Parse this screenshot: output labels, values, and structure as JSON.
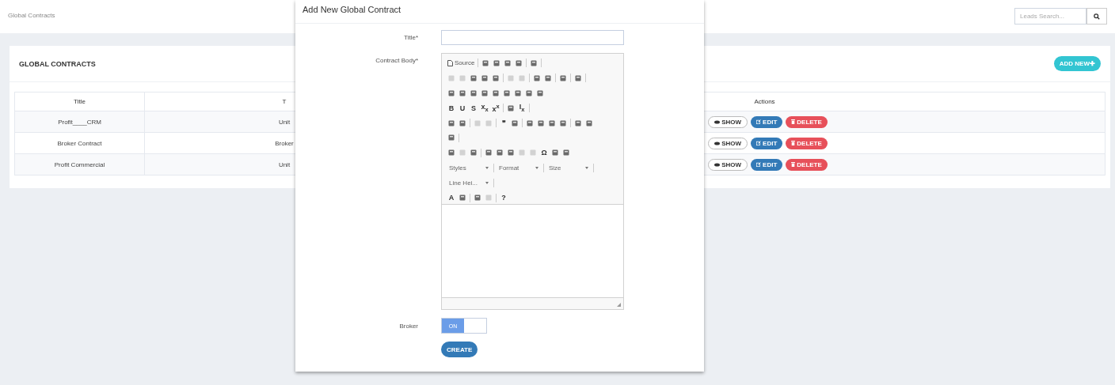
{
  "breadcrumb": "Global Contracts",
  "search": {
    "placeholder": "Leads Search..."
  },
  "card": {
    "title": "GLOBAL CONTRACTS",
    "add_button": "ADD NEW✚"
  },
  "table": {
    "columns": [
      "Title",
      "T",
      "Actions"
    ],
    "rows": [
      {
        "title": "Profit____CRM",
        "column_2": "Unit",
        "actions": [
          "SHOW",
          "EDIT",
          "DELETE"
        ]
      },
      {
        "title": "Broker Contract",
        "column_2": "Broker",
        "actions": [
          "SHOW",
          "EDIT",
          "DELETE"
        ]
      },
      {
        "title": "Profit Commercial",
        "column_2": "Unit",
        "actions": [
          "SHOW",
          "EDIT",
          "DELETE"
        ]
      }
    ]
  },
  "modal": {
    "title": "Add New Global Contract",
    "title_label": "Title*",
    "body_label": "Contract Body*",
    "toolbar": [
      [
        {
          "kind": "source",
          "label": "Source"
        },
        {
          "kind": "sep"
        },
        {
          "kind": "icon"
        },
        {
          "kind": "icon"
        },
        {
          "kind": "icon"
        },
        {
          "kind": "icon"
        },
        {
          "kind": "sep"
        },
        {
          "kind": "icon"
        },
        {
          "kind": "sep"
        }
      ],
      [
        {
          "kind": "faint"
        },
        {
          "kind": "faint"
        },
        {
          "kind": "icon"
        },
        {
          "kind": "icon"
        },
        {
          "kind": "icon"
        },
        {
          "kind": "sep"
        },
        {
          "kind": "faint"
        },
        {
          "kind": "faint"
        },
        {
          "kind": "sep"
        },
        {
          "kind": "icon"
        },
        {
          "kind": "icon"
        },
        {
          "kind": "sep"
        },
        {
          "kind": "icon"
        },
        {
          "kind": "sep"
        },
        {
          "kind": "icon"
        },
        {
          "kind": "sep"
        }
      ],
      [
        {
          "kind": "icon"
        },
        {
          "kind": "icon"
        },
        {
          "kind": "icon"
        },
        {
          "kind": "icon"
        },
        {
          "kind": "icon"
        },
        {
          "kind": "icon"
        },
        {
          "kind": "icon"
        },
        {
          "kind": "icon"
        },
        {
          "kind": "icon"
        }
      ],
      [
        {
          "kind": "glyph",
          "label": "B"
        },
        {
          "kind": "glyph",
          "label": "U"
        },
        {
          "kind": "glyph",
          "label": "S"
        },
        {
          "kind": "glyph",
          "label": "x$_{x}$"
        },
        {
          "kind": "glyph",
          "label": "x$^{x}$"
        },
        {
          "kind": "sep"
        },
        {
          "kind": "icon"
        },
        {
          "kind": "glyph",
          "label": "I$_{x}$"
        },
        {
          "kind": "sep"
        }
      ],
      [
        {
          "kind": "icon"
        },
        {
          "kind": "icon"
        },
        {
          "kind": "sep"
        },
        {
          "kind": "faint"
        },
        {
          "kind": "faint"
        },
        {
          "kind": "sep"
        },
        {
          "kind": "glyph",
          "label": "❞"
        },
        {
          "kind": "icon"
        },
        {
          "kind": "sep"
        },
        {
          "kind": "icon"
        },
        {
          "kind": "icon"
        },
        {
          "kind": "icon"
        },
        {
          "kind": "icon"
        },
        {
          "kind": "sep"
        },
        {
          "kind": "icon"
        },
        {
          "kind": "icon"
        }
      ],
      [
        {
          "kind": "icon"
        },
        {
          "kind": "sep"
        }
      ],
      [
        {
          "kind": "icon"
        },
        {
          "kind": "faint"
        },
        {
          "kind": "icon"
        },
        {
          "kind": "sep"
        },
        {
          "kind": "icon"
        },
        {
          "kind": "icon"
        },
        {
          "kind": "icon"
        },
        {
          "kind": "faint"
        },
        {
          "kind": "faint"
        },
        {
          "kind": "glyph",
          "label": "Ω"
        },
        {
          "kind": "icon"
        },
        {
          "kind": "icon"
        }
      ],
      [
        {
          "kind": "combo",
          "label": "Styles"
        },
        {
          "kind": "sep"
        },
        {
          "kind": "combo",
          "label": "Format"
        },
        {
          "kind": "sep"
        },
        {
          "kind": "combo",
          "label": "Size"
        },
        {
          "kind": "sep"
        }
      ],
      [
        {
          "kind": "combo",
          "label": "Line Hei..."
        },
        {
          "kind": "sep"
        }
      ],
      [
        {
          "kind": "glyph",
          "label": "A"
        },
        {
          "kind": "icon"
        },
        {
          "kind": "sep"
        },
        {
          "kind": "icon"
        },
        {
          "kind": "faint"
        },
        {
          "kind": "sep"
        },
        {
          "kind": "glyph",
          "label": "?"
        }
      ]
    ],
    "broker_label": "Broker",
    "broker_toggle": {
      "on": true,
      "label": "ON"
    },
    "create_button": "CREATE"
  }
}
